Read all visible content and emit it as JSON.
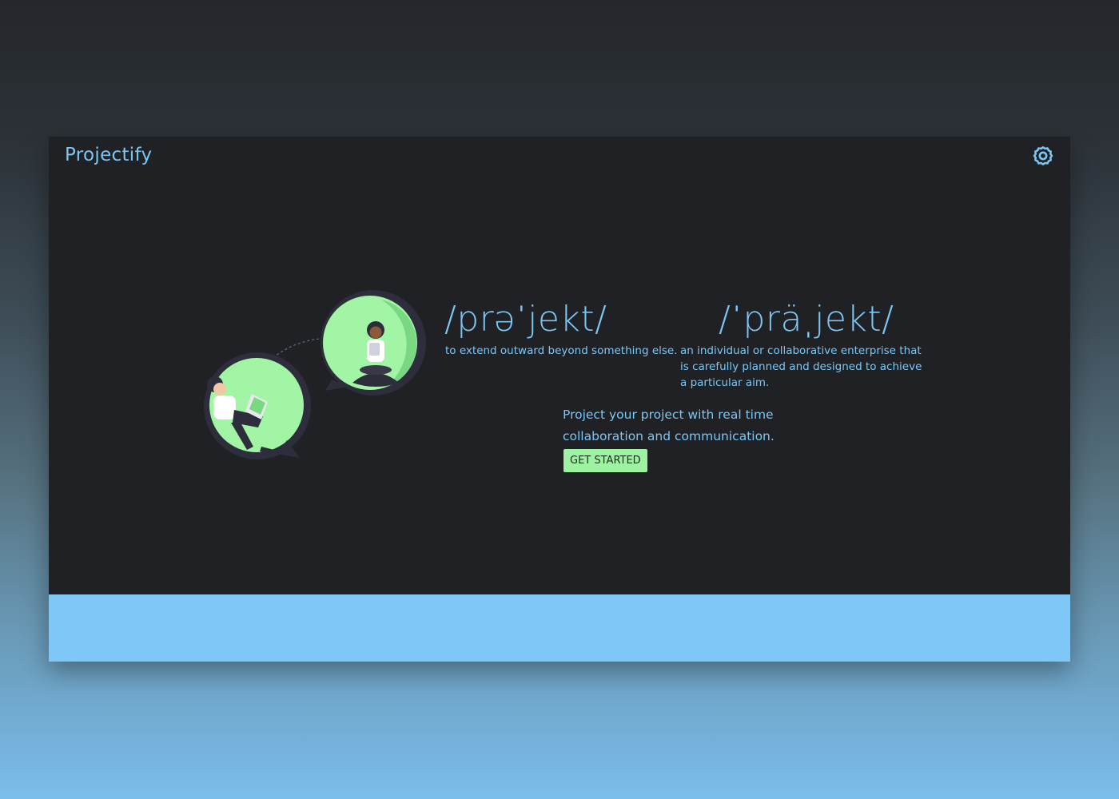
{
  "app": {
    "brand": "Projectify",
    "settings_icon": "gear-icon"
  },
  "hero": {
    "verb_pronunciation": "/prəˈjekt/",
    "verb_definition": "to extend outward beyond something else.",
    "noun_pronunciation": "/ˈpräˌjekt/",
    "noun_definition": "an individual or collaborative enterprise that is carefully planned and designed to achieve a particular aim.",
    "tagline": "Project your project with real time collaboration and communication.",
    "cta_label": "GET STARTED",
    "illustration": "two-people-chat-bubbles-illustration"
  },
  "colors": {
    "accent_blue": "#7cc6f4",
    "accent_green": "#9ef3a3",
    "panel_bg": "#202124"
  }
}
